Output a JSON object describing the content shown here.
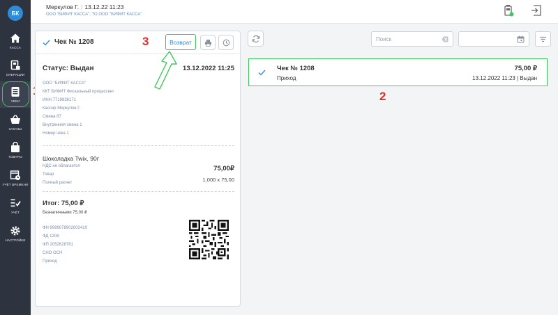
{
  "sidebar": {
    "logo": "БК",
    "items": [
      {
        "label": "Касса",
        "icon": "home-icon"
      },
      {
        "label": "Операции",
        "icon": "operations-icon"
      },
      {
        "label": "Чеки",
        "icon": "receipts-icon"
      },
      {
        "label": "Заказы",
        "icon": "basket-icon"
      },
      {
        "label": "Товары",
        "icon": "bag-icon"
      },
      {
        "label": "Учёт времени",
        "icon": "timesheet-icon"
      },
      {
        "label": "Учёт",
        "icon": "accounting-icon"
      },
      {
        "label": "Настройки",
        "icon": "gear-icon"
      }
    ],
    "active_index": 2
  },
  "header": {
    "user": "Меркулов Г.",
    "datetime": "13.12.22 11:23",
    "org": "ООО \"БИФИТ КАССА\"; ТО ООО \"БИФИТ КАССА\""
  },
  "receipt": {
    "title": "Чек № 1208",
    "return_label": "Возврат",
    "status": "Статус: Выдан",
    "date": "13.12.2022 11:25",
    "meta": [
      "ООО \"БИФИТ КАССА\"",
      "ККТ БИФИТ Фискальный процессинг",
      "ИНН 7719836171",
      "Кассир Меркулов Г.",
      "Смена 87",
      "Внутренняя смена 1",
      "Номер чека 1"
    ],
    "item": {
      "name": "Шоколадка Twix, 90г",
      "details": [
        "НДС не облагается",
        "Товар",
        "Полный расчет"
      ],
      "price": "75,00₽",
      "qty": "1,000 x 75,00"
    },
    "total": "Итог: 75,00 ₽",
    "cashless": "Безналичными 75,00 ₽",
    "fiscal": [
      "ФН 9999078902002410",
      "ФД 1208",
      "ФП 2052628781",
      "СНО ОСН",
      "Приход"
    ]
  },
  "toolbar": {
    "search_placeholder": "Поиск"
  },
  "list": [
    {
      "title": "Чек № 1208",
      "type": "Приход",
      "amount": "75,00 ₽",
      "datetime": "13.12.2022 11:23",
      "status": "Выдан"
    }
  ],
  "annotations": {
    "n1": "1",
    "n2": "2",
    "n3": "3"
  },
  "colors": {
    "accent": "#2f8bd8",
    "highlight": "#3ec75a",
    "annotation": "#d63232",
    "sidebar": "#2e3340"
  }
}
